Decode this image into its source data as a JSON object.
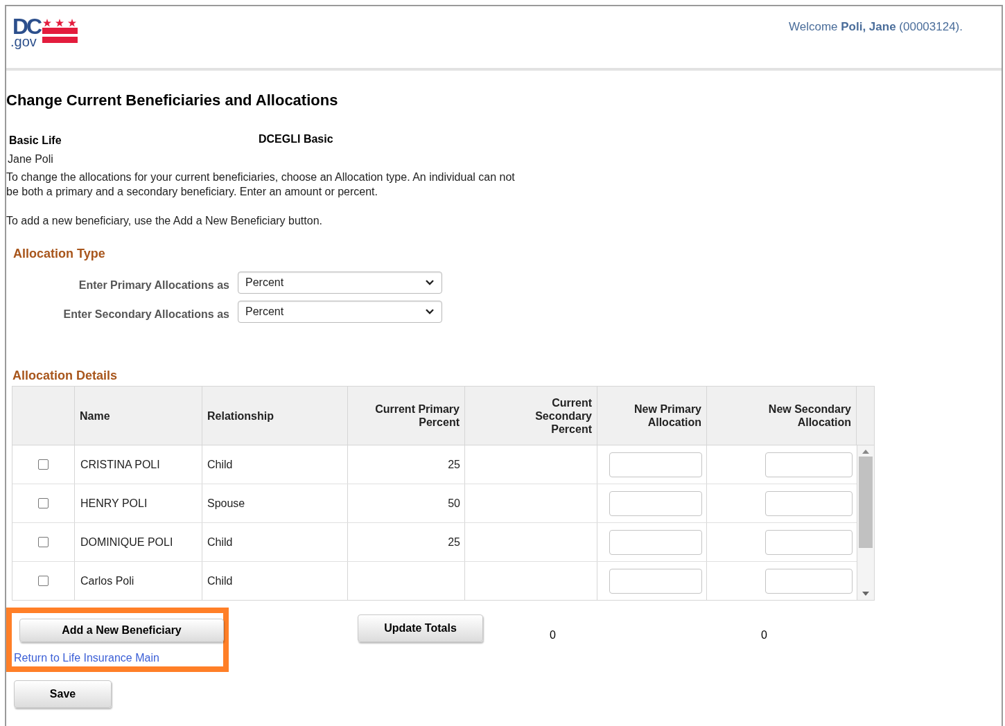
{
  "header": {
    "logo": {
      "main": "DC",
      "sub": ".gov"
    },
    "welcome": "Welcome **Poli, Jane** (00003124)."
  },
  "title": "Change Current Beneficiaries and Allocations",
  "plan": {
    "name": "Basic Life",
    "code": "DCEGLI Basic",
    "employee": "Jane Poli"
  },
  "instructions": [
    "To change the allocations for your current beneficiaries, choose an Allocation type. An individual can not be both a primary and a secondary beneficiary. Enter an amount or percent.",
    "To add a new beneficiary, use the Add a New Beneficiary button."
  ],
  "allocation_type": {
    "heading": "Allocation Type",
    "fields": [
      {
        "label": "Enter Primary Allocations as",
        "value": "Percent"
      },
      {
        "label": "Enter Secondary Allocations as",
        "value": "Percent"
      }
    ]
  },
  "allocation_details": {
    "heading": "Allocation Details",
    "columns": [
      "Name",
      "Relationship",
      "Current Primary Percent",
      "Current Secondary Percent",
      "New Primary Allocation",
      "New Secondary Allocation"
    ],
    "rows": [
      {
        "checked": false,
        "name": "CRISTINA POLI",
        "relationship": "Child",
        "current_primary": "25"
      },
      {
        "checked": false,
        "name": "HENRY POLI",
        "relationship": "Spouse",
        "current_primary": "50"
      },
      {
        "checked": false,
        "name": "DOMINIQUE POLI",
        "relationship": "Child",
        "current_primary": "25"
      },
      {
        "checked": false,
        "name": "Carlos Poli",
        "relationship": "Child"
      }
    ]
  },
  "actions": {
    "highlighted": true,
    "add_button": "Add a New Beneficiary",
    "return_link": "Return to Life Insurance Main",
    "update_button": "Update Totals",
    "totals": [
      "0",
      "0"
    ],
    "save_button": "Save"
  }
}
